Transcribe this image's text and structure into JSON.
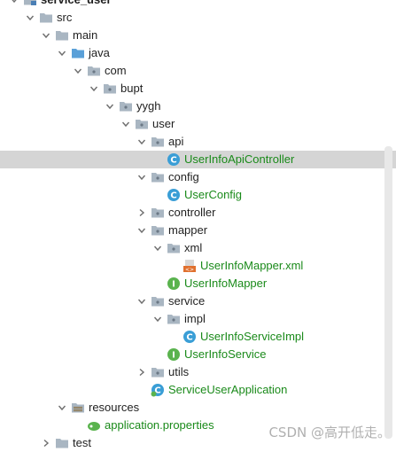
{
  "tree": [
    {
      "label": "service_user",
      "depth": 1,
      "expanded": true,
      "icon": "module-icon",
      "bold": true
    },
    {
      "label": "src",
      "depth": 2,
      "expanded": true,
      "icon": "folder-icon"
    },
    {
      "label": "main",
      "depth": 3,
      "expanded": true,
      "icon": "folder-icon"
    },
    {
      "label": "java",
      "depth": 4,
      "expanded": true,
      "icon": "source-folder-icon"
    },
    {
      "label": "com",
      "depth": 5,
      "expanded": true,
      "icon": "package-icon"
    },
    {
      "label": "bupt",
      "depth": 6,
      "expanded": true,
      "icon": "package-icon"
    },
    {
      "label": "yygh",
      "depth": 7,
      "expanded": true,
      "icon": "package-icon"
    },
    {
      "label": "user",
      "depth": 8,
      "expanded": true,
      "icon": "package-icon"
    },
    {
      "label": "api",
      "depth": 9,
      "expanded": true,
      "icon": "package-icon"
    },
    {
      "label": "UserInfoApiController",
      "depth": 10,
      "icon": "class-icon",
      "green": true,
      "selected": true
    },
    {
      "label": "config",
      "depth": 9,
      "expanded": true,
      "icon": "package-icon"
    },
    {
      "label": "UserConfig",
      "depth": 10,
      "icon": "class-icon",
      "green": true
    },
    {
      "label": "controller",
      "depth": 9,
      "expanded": false,
      "icon": "package-icon"
    },
    {
      "label": "mapper",
      "depth": 9,
      "expanded": true,
      "icon": "package-icon"
    },
    {
      "label": "xml",
      "depth": 10,
      "expanded": true,
      "icon": "package-icon"
    },
    {
      "label": "UserInfoMapper.xml",
      "depth": 11,
      "icon": "xml-file-icon",
      "green": true
    },
    {
      "label": "UserInfoMapper",
      "depth": 10,
      "icon": "interface-icon",
      "green": true
    },
    {
      "label": "service",
      "depth": 9,
      "expanded": true,
      "icon": "package-icon"
    },
    {
      "label": "impl",
      "depth": 10,
      "expanded": true,
      "icon": "package-icon"
    },
    {
      "label": "UserInfoServiceImpl",
      "depth": 11,
      "icon": "class-icon",
      "green": true
    },
    {
      "label": "UserInfoService",
      "depth": 10,
      "icon": "interface-icon",
      "green": true
    },
    {
      "label": "utils",
      "depth": 9,
      "expanded": false,
      "icon": "package-icon"
    },
    {
      "label": "ServiceUserApplication",
      "depth": 9,
      "icon": "spring-boot-class-icon",
      "green": true
    },
    {
      "label": "resources",
      "depth": 4,
      "expanded": true,
      "icon": "resources-folder-icon"
    },
    {
      "label": "application.properties",
      "depth": 5,
      "icon": "spring-properties-icon",
      "green": true
    },
    {
      "label": "test",
      "depth": 3,
      "expanded": false,
      "icon": "folder-icon"
    }
  ],
  "watermark": "CSDN @高开低走。",
  "colors": {
    "vcs_added": "#1a8a1a",
    "selection": "#d5d5d5",
    "folder": "#a9b6c2",
    "source_folder": "#5aa0d8",
    "class": "#3a9ed6",
    "interface": "#5ab34e"
  }
}
